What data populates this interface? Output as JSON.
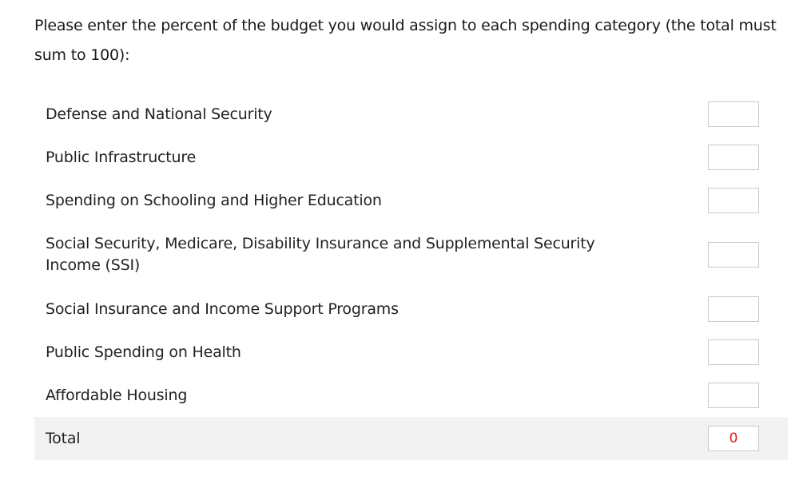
{
  "question": {
    "text": "Please enter the percent of the budget you would assign to each spending category (the total must sum to 100):"
  },
  "categories": [
    {
      "label": "Defense and National Security",
      "value": ""
    },
    {
      "label": "Public Infrastructure",
      "value": ""
    },
    {
      "label": "Spending on Schooling and Higher Education",
      "value": ""
    },
    {
      "label": "Social Security, Medicare, Disability Insurance and Supplemental Security Income (SSI)",
      "value": ""
    },
    {
      "label": "Social Insurance and Income Support Programs",
      "value": ""
    },
    {
      "label": "Public Spending on Health",
      "value": ""
    },
    {
      "label": "Affordable Housing",
      "value": ""
    }
  ],
  "total": {
    "label": "Total",
    "value": "0",
    "value_color": "#e02020"
  }
}
